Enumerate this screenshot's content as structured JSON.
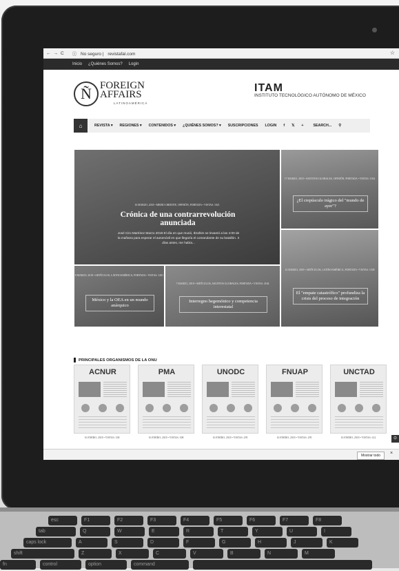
{
  "browser": {
    "security": "No seguro",
    "url": "revistafal.com"
  },
  "topbar": {
    "items": [
      "Inicio",
      "¿Quiénes Somos?",
      "Login"
    ]
  },
  "header": {
    "logo_letter": "Ñ",
    "logo_line1": "FOREIGN",
    "logo_line2": "AFFAIRS",
    "logo_sub": "LATINOAMÉRICA",
    "partner_mark": "ITAM",
    "partner_name": "INSTITUTO TECNOLÓGICO AUTÓNOMO DE MÉXICO"
  },
  "nav": {
    "items": [
      "REVISTA ▾",
      "REGIONES ▾",
      "CONTENIDOS ▾",
      "¿QUIÉNES SOMOS? ▾",
      "SUSCRIPCIONES",
      "LOGIN",
      "f",
      "𝕏",
      "+"
    ],
    "search": "SEARCH..."
  },
  "hero": {
    "main": {
      "meta": "16 MARZO, 2018 • MEDIO ORIENTE, OPINIÓN, PORTADA • VISTAS: 1021",
      "title": "Crónica de una contrarrevolución anunciada",
      "excerpt": "José Ciro Martínez Marzo 2018 El día en que murió, Ibrahim se levantó a las 4:00 de la mañana para esperar el automóvil en que llegaría el comandante de su batallón. 3 días antes, me había..."
    },
    "right_top": {
      "meta": "17 MARZO, 2018 • ASUNTOS GLOBALES, OPINIÓN, PORTADA • VISTAS: 1014",
      "title": "¿El crepúsculo trágico del \"mundo de ayer\"?"
    },
    "right_bottom": {
      "meta": "12 MARZO, 2018 • ARTÍCULOS, LATINOAMÉRICA, PORTADA • VISTAS: 1549",
      "title": "El \"empate catastrófico\" profundiza la crisis del proceso de integración"
    },
    "bottom_left": {
      "meta": "8 MARZO, 2018 • ARTÍCULOS, LATINOAMÉRICA, PORTADA • VISTAS: 1281",
      "title": "México y la OEA en un mundo anárquico"
    },
    "bottom_mid": {
      "meta": "7 MARZO, 2018 • ARTÍCULOS, ASUNTOS GLOBALES, PORTADA • VISTAS: 2164",
      "title": "Interregno hegemónico y competencia interestatal"
    }
  },
  "section": {
    "title": "PRINCIPALES ORGANISMOS DE LA ONU",
    "cards": [
      {
        "brand": "ACNUR",
        "caption": "16 ENERO, 2018 • VISTAS: 338"
      },
      {
        "brand": "PMA",
        "caption": "16 ENERO, 2018 • VISTAS: 308"
      },
      {
        "brand": "UNODC",
        "caption": "16 ENERO, 2018 • VISTAS: 295"
      },
      {
        "brand": "FNUAP",
        "caption": "16 ENERO, 2018 • VISTAS: 295"
      },
      {
        "brand": "UNCTAD",
        "caption": "16 ENERO, 2018 • VISTAS: 412"
      }
    ]
  },
  "downloads": {
    "show_all": "Mostrar todo",
    "close": "×"
  },
  "keyboard": {
    "row1": [
      "esc",
      "F1",
      "F2",
      "F3",
      "F4",
      "F5",
      "F6",
      "F7",
      "F8"
    ],
    "row2": [
      "tab",
      "Q",
      "W",
      "E",
      "R",
      "T",
      "Y",
      "U",
      "I"
    ],
    "row3": [
      "caps lock",
      "A",
      "S",
      "D",
      "F",
      "G",
      "H",
      "J",
      "K"
    ],
    "row4": [
      "shift",
      "Z",
      "X",
      "C",
      "V",
      "B",
      "N",
      "M"
    ],
    "row5": [
      "fn",
      "control",
      "option",
      "command",
      ""
    ]
  }
}
